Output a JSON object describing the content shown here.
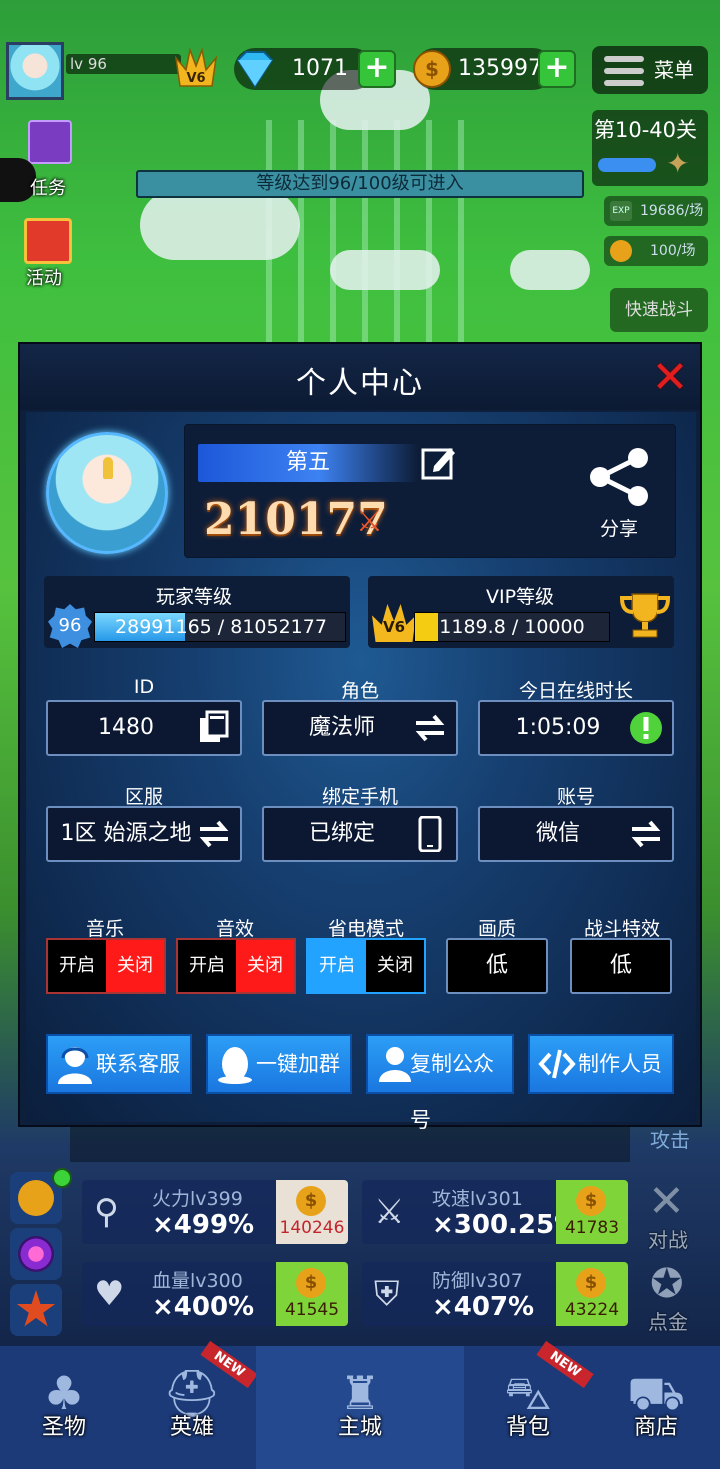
{
  "top_bar": {
    "level": "lv 96",
    "vip": "V6",
    "diamonds": "1071",
    "coins": "135997",
    "menu_label": "菜单"
  },
  "side_menu": {
    "task_label": "任务",
    "event_label": "活动"
  },
  "stage": {
    "name": "第10-40关",
    "xp_rate": "19686/场",
    "coin_rate": "100/场",
    "quick_battle": "快速战斗",
    "level_requirement": "等级达到96/100级可进入"
  },
  "modal": {
    "title": "个人中心",
    "player_name": "第五",
    "power": "210177",
    "share_label": "分享",
    "player_level_title": "玩家等级",
    "player_level": "96",
    "xp_text": "28991165 / 81052177",
    "xp_progress": 0.358,
    "vip_title": "VIP等级",
    "vip_badge": "V6",
    "vip_text": "1189.8 / 10000",
    "vip_progress": 0.119,
    "fields": {
      "id_label": "ID",
      "id_value": "1480",
      "role_label": "角色",
      "role_value": "魔法师",
      "online_label": "今日在线时长",
      "online_value": "1:05:09",
      "server_label": "区服",
      "server_value": "1区 始源之地",
      "phone_label": "绑定手机",
      "phone_value": "已绑定",
      "account_label": "账号",
      "account_value": "微信"
    },
    "settings": {
      "music_label": "音乐",
      "sfx_label": "音效",
      "power_save_label": "省电模式",
      "quality_label": "画质",
      "battle_fx_label": "战斗特效",
      "on_label": "开启",
      "off_label": "关闭",
      "quality_value": "低",
      "battle_fx_value": "低"
    },
    "buttons": {
      "support": "联系客服",
      "join_group": "一键加群",
      "copy_account": "复制公众号",
      "credits": "制作人员"
    }
  },
  "game": {
    "attack_label": "攻击",
    "upgrades": [
      {
        "name": "火力lv399",
        "value": "×499%",
        "cost": "140246"
      },
      {
        "name": "攻速lv301",
        "value": "×300.25%",
        "cost": "41783"
      },
      {
        "name": "血量lv300",
        "value": "×400%",
        "cost": "41545"
      },
      {
        "name": "防御lv307",
        "value": "×407%",
        "cost": "43224"
      }
    ],
    "battle_label": "对战",
    "gold_label": "点金"
  },
  "bottom_nav": {
    "relic": "圣物",
    "hero": "英雄",
    "main_city": "主城",
    "bag": "背包",
    "shop": "商店",
    "new_tag": "NEW"
  },
  "colors": {
    "modal_bg": "#0e1f3c",
    "toggle_red": "#ff1a1a",
    "toggle_blue": "#22a3ff",
    "button_blue": "#1f8af0",
    "close_red": "#e11d1d"
  }
}
